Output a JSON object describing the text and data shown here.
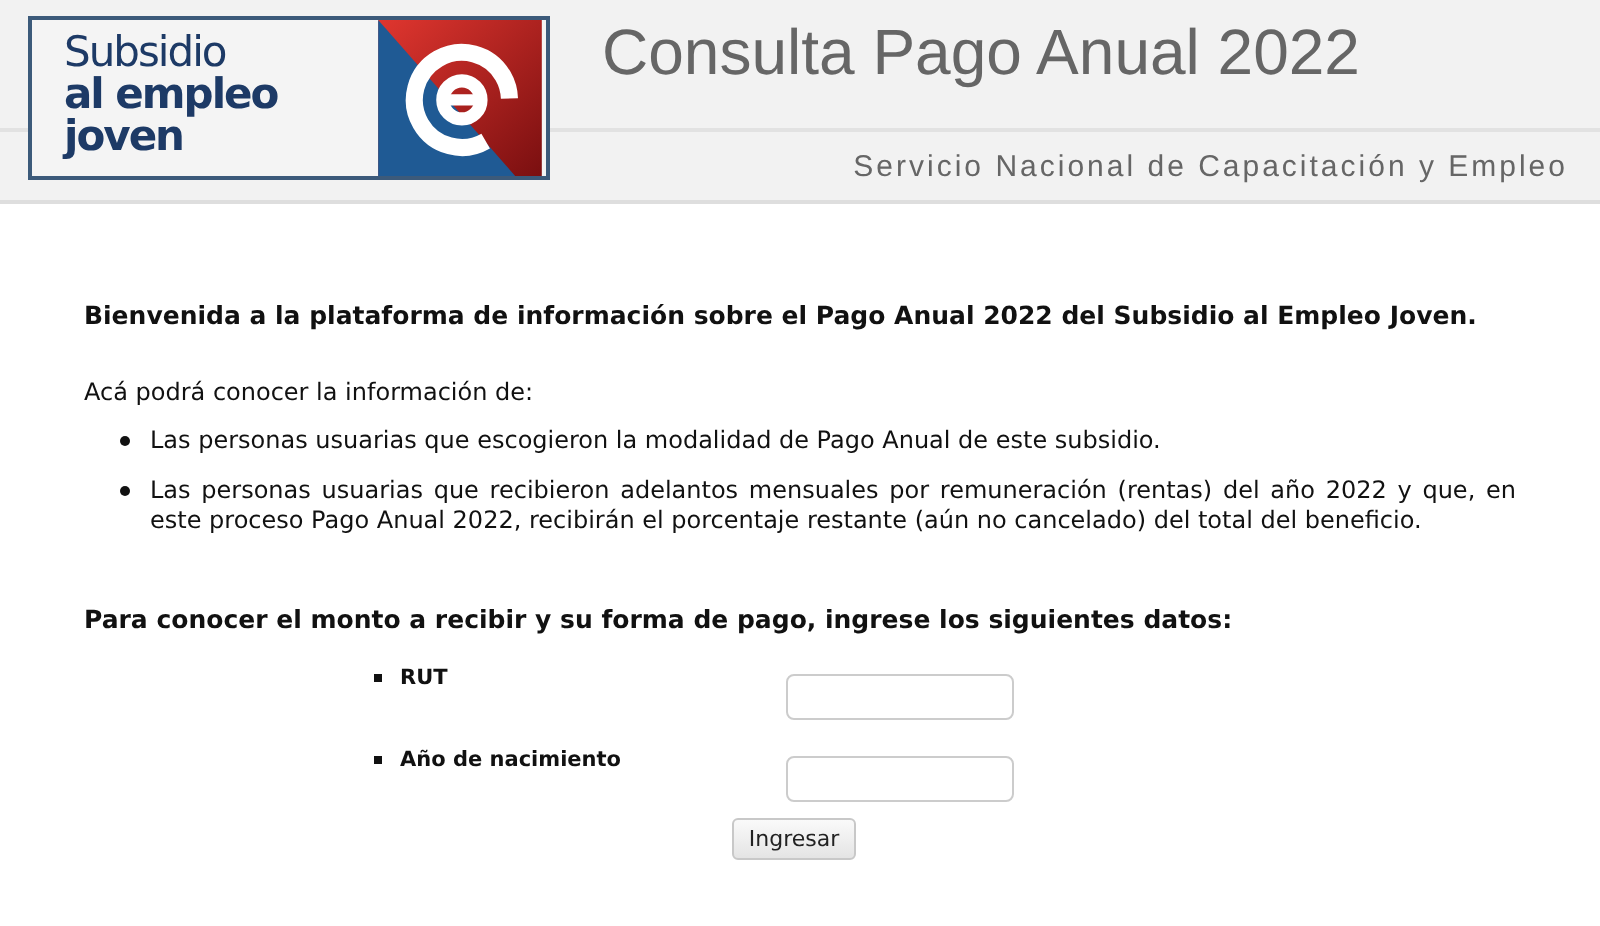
{
  "header": {
    "logo": {
      "line_1": "Subsidio",
      "line_2": "al empleo",
      "line_3": "joven"
    },
    "title": "Consulta Pago Anual 2022",
    "subtitle": "Servicio Nacional de Capacitación y Empleo"
  },
  "intro": "Bienvenida a la plataforma de información sobre el Pago Anual 2022 del Subsidio al Empleo Joven.",
  "lead": "Acá podrá conocer la información de:",
  "bullets": [
    "Las personas usuarias que escogieron la modalidad de Pago Anual de este subsidio.",
    "Las personas usuarias que recibieron adelantos mensuales por remuneración (rentas) del año 2022 y que, en este proceso Pago Anual 2022, recibirán el porcentaje restante (aún no cancelado) del total del beneficio."
  ],
  "form_heading": "Para conocer el monto a recibir y su forma de pago, ingrese los siguientes datos:",
  "fields": [
    {
      "label": "RUT"
    },
    {
      "label": "Año de nacimiento"
    }
  ],
  "submit": "Ingresar"
}
